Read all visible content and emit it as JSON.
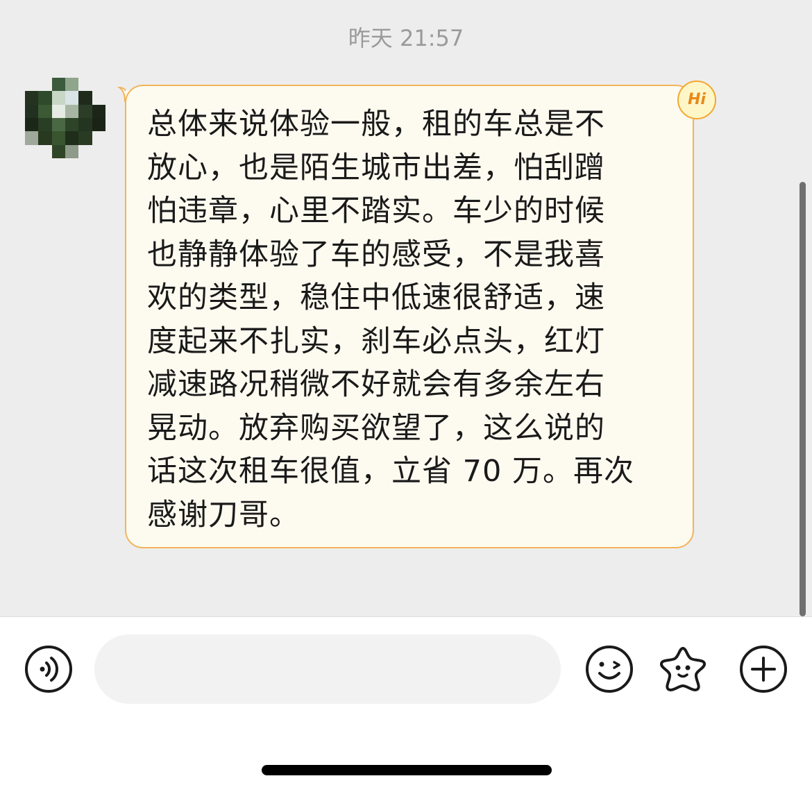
{
  "chat": {
    "timestamp": "昨天 21:57",
    "message": {
      "lines": [
        "总体来说体验一般，租的车总是不",
        "放心，也是陌生城市出差，怕刮蹭",
        "怕违章，心里不踏实。车少的时候",
        "也静静体验了车的感受，不是我喜",
        "欢的类型，稳住中低速很舒适，速",
        "度起来不扎实，刹车必点头，红灯",
        "减速路况稍微不好就会有多余左右",
        "晃动。放弃购买欲望了，这么说的",
        "话这次租车很值，立省 70 万。再次",
        "感谢刀哥。"
      ],
      "badge": "Hi"
    },
    "avatar_pixels": [
      "#ededed",
      "#ededed",
      "#3c5a3c",
      "#8fa58c",
      "#ededed",
      "#ededed",
      "#24331f",
      "#2f4a2b",
      "#c8d6c6",
      "#d9e4e6",
      "#1f2a1b",
      "#ededed",
      "#213120",
      "#3b5a33",
      "#e6ebe4",
      "#a6b6a2",
      "#2b3d27",
      "#1c2618",
      "#1b2717",
      "#2a3d25",
      "#4a6843",
      "#2d4428",
      "#233520",
      "#1a2316",
      "#9fa89b",
      "#28391f",
      "#385530",
      "#1f2e1b",
      "#2a3b24",
      "#ededed",
      "#ededed",
      "#ededed",
      "#2f4527",
      "#8e9a8a",
      "#ededed",
      "#ededed"
    ]
  },
  "input_bar": {
    "voice_icon": "voice-icon",
    "emoji_icon": "emoji-icon",
    "sticker_icon": "sticker-icon",
    "add_icon": "add-icon",
    "placeholder": ""
  },
  "colors": {
    "bubble_bg": "#fdfbf0",
    "bubble_border": "#f2b35a",
    "chat_bg": "#ededed"
  }
}
